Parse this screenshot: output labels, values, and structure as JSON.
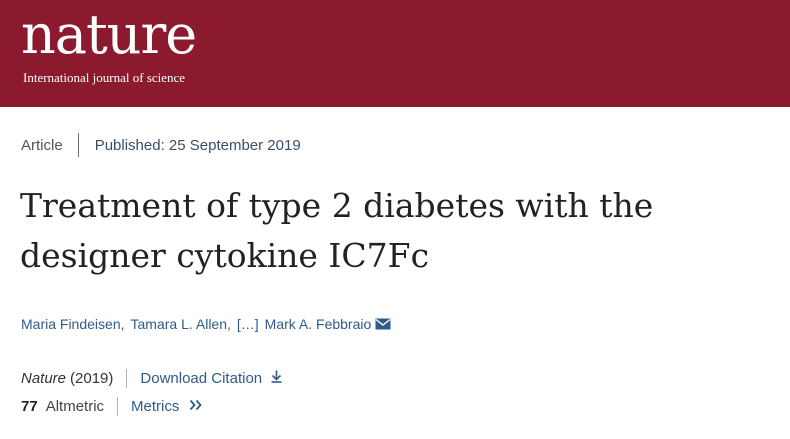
{
  "header": {
    "logo_text": "nature",
    "tagline": "International journal of science",
    "background_color": "#8b1a2f"
  },
  "article_meta": {
    "type": "Article",
    "published": "Published: 25 September 2019"
  },
  "title": {
    "line1": "Treatment of type 2 diabetes with the",
    "line2": "designer cytokine IC7Fc"
  },
  "authors": {
    "first": "Maria Findeisen,",
    "second": "Tamara L. Allen,",
    "ellipsis": "[…]",
    "last": "Mark A. Febbraio",
    "contact_icon": "envelope-icon"
  },
  "citation": {
    "journal": "Nature",
    "year": "(2019)",
    "download_label": "Download Citation",
    "download_icon": "download-arrow-icon"
  },
  "metrics": {
    "count": "77",
    "label": "Altmetric",
    "link_label": "Metrics",
    "link_icon": "double-chevron-right-icon"
  },
  "colors": {
    "link": "#2e5c8a",
    "text": "#222222"
  }
}
